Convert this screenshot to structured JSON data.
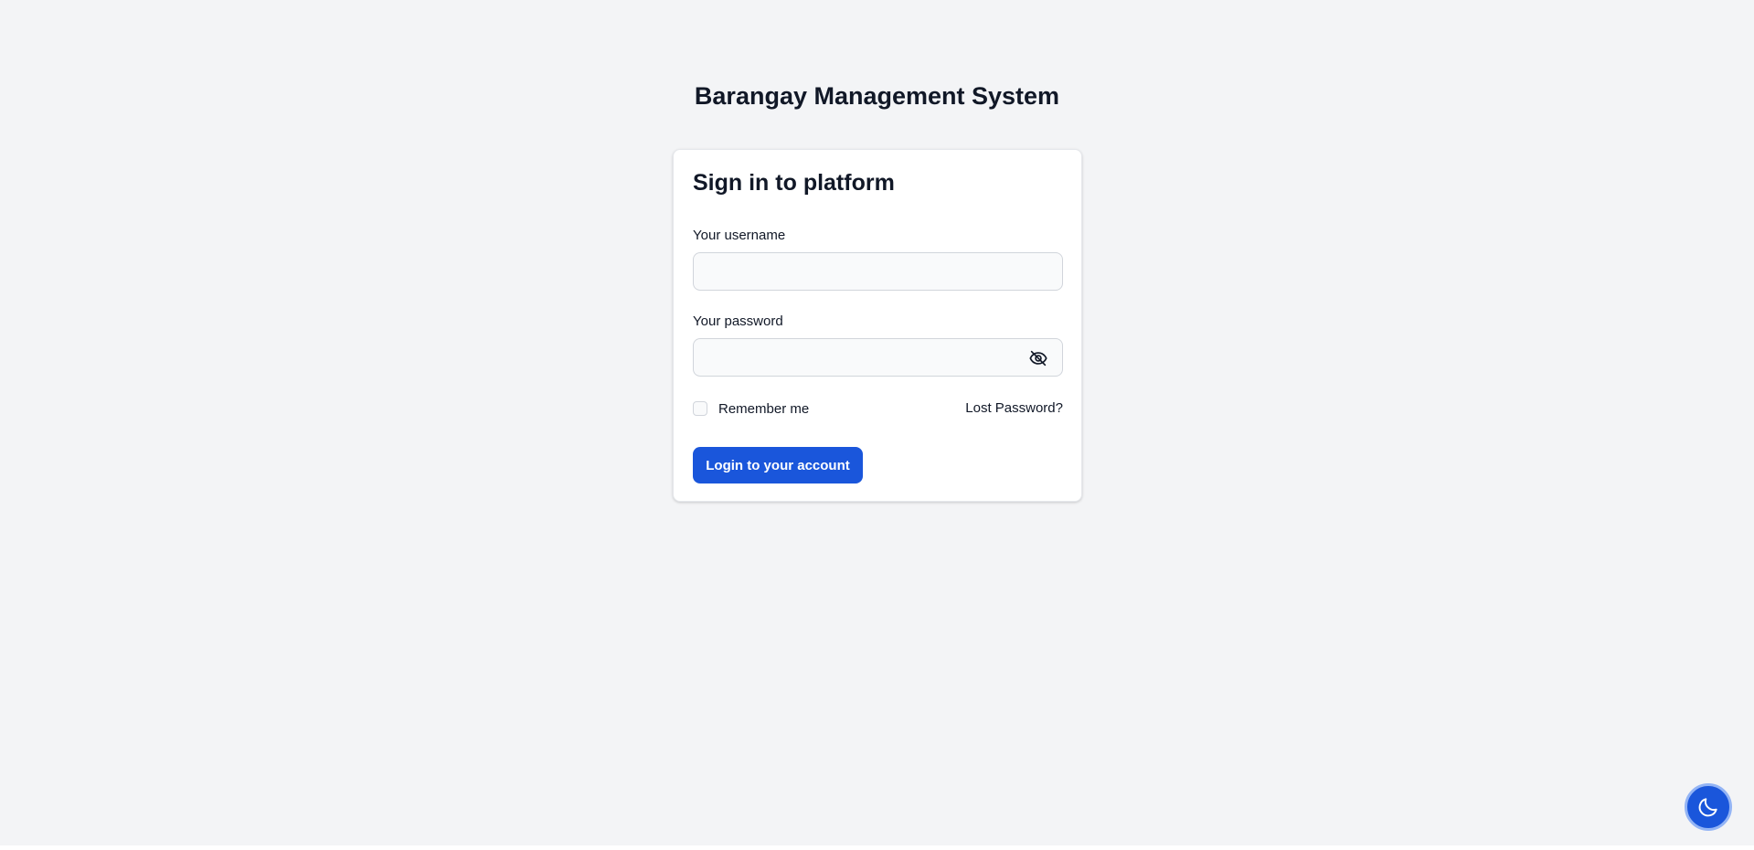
{
  "header": {
    "app_title": "Barangay Management System"
  },
  "login": {
    "card_title": "Sign in to platform",
    "username": {
      "label": "Your username",
      "value": "",
      "placeholder": ""
    },
    "password": {
      "label": "Your password",
      "value": "",
      "placeholder": ""
    },
    "remember_me_label": "Remember me",
    "remember_me_checked": false,
    "lost_password_label": "Lost Password?",
    "submit_label": "Login to your account",
    "password_toggle_icon": "eye-slash-icon"
  },
  "theme_toggle": {
    "icon": "moon-icon"
  },
  "colors": {
    "background": "#f3f4f6",
    "card": "#ffffff",
    "primary": "#1a56db",
    "text": "#111827",
    "border": "#d1d5db"
  }
}
